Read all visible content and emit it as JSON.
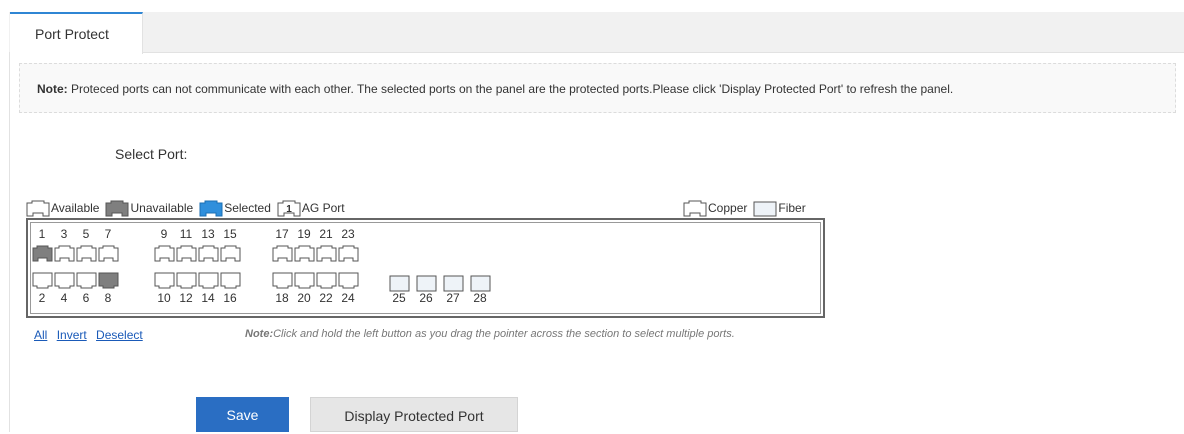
{
  "tab": {
    "label": "Port Protect"
  },
  "note": {
    "prefix": "Note:",
    "text": " Proteced ports can not communicate with each other. The selected ports on the panel are the protected ports.Please click 'Display Protected Port' to refresh the panel."
  },
  "select_port_label": "Select Port:",
  "legend": {
    "available": "Available",
    "unavailable": "Unavailable",
    "selected": "Selected",
    "ag_port": "AG Port",
    "ag_icon_number": "1",
    "copper": "Copper",
    "fiber": "Fiber"
  },
  "ports": {
    "top_row": [
      {
        "num": "1",
        "state": "unavailable"
      },
      {
        "num": "3",
        "state": "available"
      },
      {
        "num": "5",
        "state": "available"
      },
      {
        "num": "7",
        "state": "available"
      },
      {
        "num": "9",
        "state": "available"
      },
      {
        "num": "11",
        "state": "available"
      },
      {
        "num": "13",
        "state": "available"
      },
      {
        "num": "15",
        "state": "available"
      },
      {
        "num": "17",
        "state": "available"
      },
      {
        "num": "19",
        "state": "available"
      },
      {
        "num": "21",
        "state": "available"
      },
      {
        "num": "23",
        "state": "available"
      }
    ],
    "bottom_row": [
      {
        "num": "2",
        "state": "available"
      },
      {
        "num": "4",
        "state": "available"
      },
      {
        "num": "6",
        "state": "available"
      },
      {
        "num": "8",
        "state": "unavailable"
      },
      {
        "num": "10",
        "state": "available"
      },
      {
        "num": "12",
        "state": "available"
      },
      {
        "num": "14",
        "state": "available"
      },
      {
        "num": "16",
        "state": "available"
      },
      {
        "num": "18",
        "state": "available"
      },
      {
        "num": "20",
        "state": "available"
      },
      {
        "num": "22",
        "state": "available"
      },
      {
        "num": "24",
        "state": "available"
      }
    ],
    "fiber": [
      {
        "num": "25",
        "state": "available"
      },
      {
        "num": "26",
        "state": "available"
      },
      {
        "num": "27",
        "state": "available"
      },
      {
        "num": "28",
        "state": "available"
      }
    ]
  },
  "links": {
    "all": "All",
    "invert": "Invert",
    "deselect": "Deselect"
  },
  "drag_note": {
    "prefix": "Note:",
    "text": "Click and hold the left button as you drag the pointer across the section to select multiple ports."
  },
  "buttons": {
    "save": "Save",
    "display": "Display Protected Port"
  },
  "colors": {
    "available": "#ffffff",
    "unavailable": "#7f7f7f",
    "selected": "#2f8fdc",
    "fiber": "#eef3f8",
    "accent": "#2a6ec3"
  }
}
